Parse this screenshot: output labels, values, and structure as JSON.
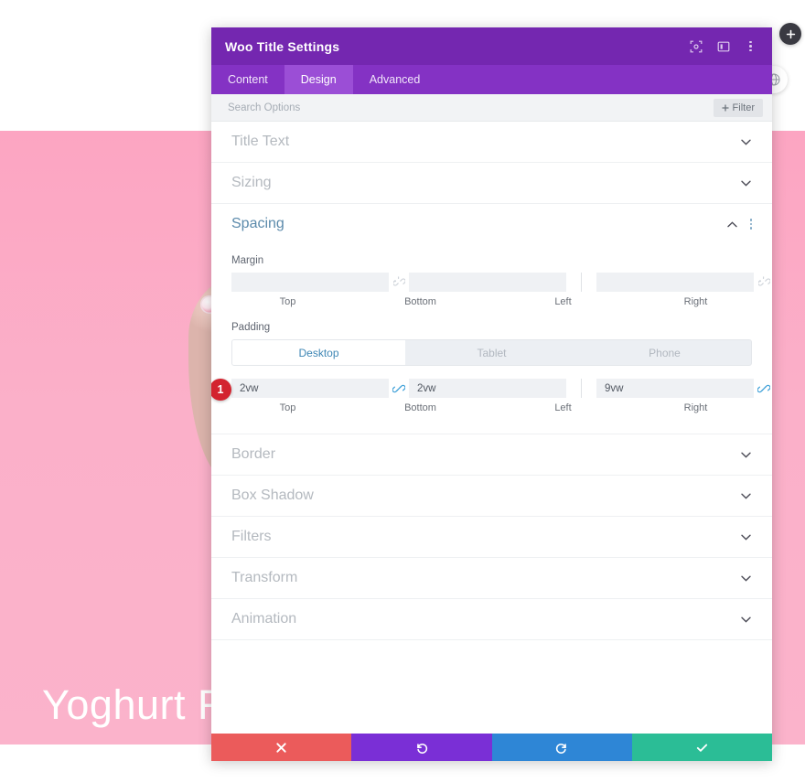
{
  "page": {
    "hero_title": "Yoghurt Ras",
    "background_color": "#fbb0c9"
  },
  "floating": {
    "add_label": "+",
    "add_icon": "plus-icon",
    "globe_icon": "globe-icon"
  },
  "modal": {
    "title": "Woo Title Settings",
    "header_icons": [
      {
        "name": "focus-target-icon"
      },
      {
        "name": "layout-panel-icon"
      },
      {
        "name": "more-vertical-icon"
      }
    ],
    "tabs": [
      {
        "label": "Content",
        "active": false
      },
      {
        "label": "Design",
        "active": true
      },
      {
        "label": "Advanced",
        "active": false
      }
    ],
    "search": {
      "placeholder": "Search Options",
      "value": ""
    },
    "filter_button": {
      "label": "Filter",
      "icon": "plus-icon"
    },
    "sections": [
      {
        "name": "Title Text",
        "open": false,
        "chevron": "chevron-down-icon"
      },
      {
        "name": "Sizing",
        "open": false,
        "chevron": "chevron-down-icon"
      },
      {
        "name": "Spacing",
        "open": true,
        "chevron": "chevron-up-icon"
      },
      {
        "name": "Border",
        "open": false,
        "chevron": "chevron-down-icon"
      },
      {
        "name": "Box Shadow",
        "open": false,
        "chevron": "chevron-down-icon"
      },
      {
        "name": "Filters",
        "open": false,
        "chevron": "chevron-down-icon"
      },
      {
        "name": "Transform",
        "open": false,
        "chevron": "chevron-down-icon"
      },
      {
        "name": "Animation",
        "open": false,
        "chevron": "chevron-down-icon"
      }
    ],
    "spacing": {
      "margin": {
        "label": "Margin",
        "top": "",
        "bottom": "",
        "left": "",
        "right": "",
        "placeholder": "",
        "labels": {
          "top": "Top",
          "bottom": "Bottom",
          "left": "Left",
          "right": "Right"
        },
        "vertical_link_state": "unlinked",
        "horizontal_link_state": "unlinked",
        "link_icon": "broken-link-icon"
      },
      "padding": {
        "label": "Padding",
        "top": "2vw",
        "bottom": "2vw",
        "left": "9vw",
        "right": "9vw",
        "labels": {
          "top": "Top",
          "bottom": "Bottom",
          "left": "Left",
          "right": "Right"
        },
        "vertical_link_state": "linked",
        "horizontal_link_state": "linked",
        "link_icon": "link-icon",
        "devices": [
          {
            "label": "Desktop",
            "active": true
          },
          {
            "label": "Tablet",
            "active": false
          },
          {
            "label": "Phone",
            "active": false
          }
        ],
        "step_badge": "1"
      }
    },
    "footer": [
      {
        "name": "cancel-button",
        "icon": "close-icon",
        "color": "#eb5b5b"
      },
      {
        "name": "undo-button",
        "icon": "undo-icon",
        "color": "#7a2fd6"
      },
      {
        "name": "redo-button",
        "icon": "redo-icon",
        "color": "#2e86d6"
      },
      {
        "name": "save-button",
        "icon": "check-icon",
        "color": "#2bbd96"
      }
    ]
  }
}
